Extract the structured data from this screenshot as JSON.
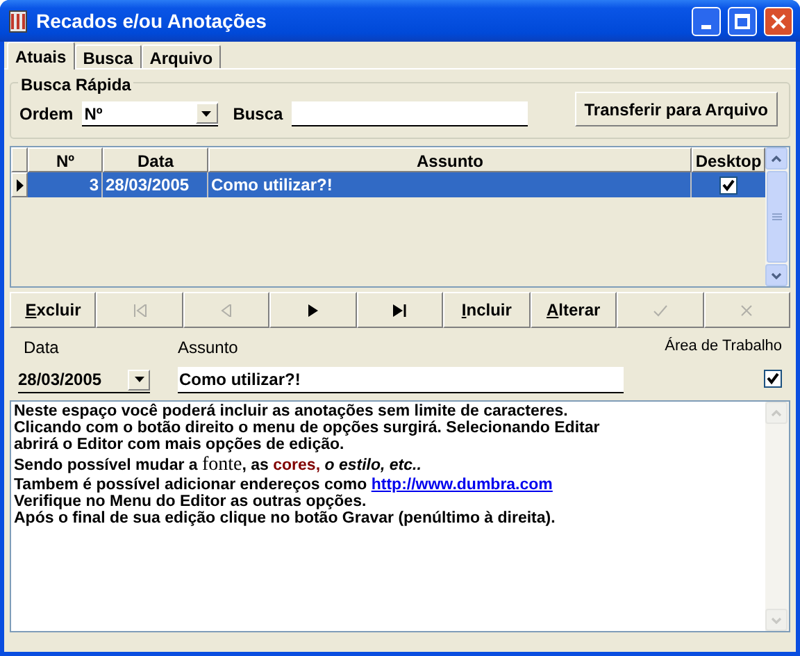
{
  "window": {
    "title": "Recados e/ou Anotações"
  },
  "tabs": [
    {
      "label": "Atuais",
      "selected": true
    },
    {
      "label": "Busca",
      "selected": false
    },
    {
      "label": "Arquivo",
      "selected": false
    }
  ],
  "quick_search": {
    "title": "Busca Rápida",
    "order_label": "Ordem",
    "order_value": "Nº",
    "search_label": "Busca",
    "transfer_button": "Transferir para Arquivo"
  },
  "table": {
    "columns": [
      "Nº",
      "Data",
      "Assunto",
      "Desktop"
    ],
    "rows": [
      {
        "number": "3",
        "date": "28/03/2005",
        "subject": "Como utilizar?!",
        "desktop": true,
        "selected": true
      }
    ]
  },
  "navigator": [
    {
      "kind": "text",
      "hotkey": "E",
      "rest": "xcluir",
      "disabled": false
    },
    {
      "kind": "first",
      "disabled": true
    },
    {
      "kind": "prev",
      "disabled": true
    },
    {
      "kind": "next",
      "disabled": false
    },
    {
      "kind": "last",
      "disabled": false
    },
    {
      "kind": "text",
      "hotkey": "I",
      "rest": "ncluir",
      "disabled": false
    },
    {
      "kind": "text",
      "hotkey": "A",
      "rest": "lterar",
      "disabled": false
    },
    {
      "kind": "post",
      "disabled": true
    },
    {
      "kind": "cancel",
      "disabled": true
    }
  ],
  "form": {
    "date_label": "Data",
    "date_value": "28/03/2005",
    "subject_label": "Assunto",
    "subject_value": "Como utilizar?!",
    "desktop_label": "Área de Trabalho",
    "desktop_checked": true
  },
  "memo": [
    [
      {
        "kind": "plain",
        "text": "Neste espaço você poderá incluir as anotações sem limite de caracteres."
      }
    ],
    [
      {
        "kind": "plain",
        "text": "Clicando com o botão direito o menu de opções surgirá. Selecionando Editar"
      }
    ],
    [
      {
        "kind": "plain",
        "text": "abrirá o Editor com mais opções de edição."
      }
    ],
    [
      {
        "kind": "plain",
        "text": "Sendo possível mudar a "
      },
      {
        "kind": "serif",
        "text": "fonte"
      },
      {
        "kind": "plain",
        "text": ", as "
      },
      {
        "kind": "colored",
        "text": "cores,",
        "color": "#800000"
      },
      {
        "kind": "italic",
        "text": " o estilo, etc.."
      }
    ],
    [
      {
        "kind": "plain",
        "text": "Tambem é possível adicionar endereços como "
      },
      {
        "kind": "link",
        "text": "http://www.dumbra.com"
      }
    ],
    [
      {
        "kind": "plain",
        "text": "Verifique no Menu do Editor as outras opções."
      }
    ],
    [
      {
        "kind": "plain",
        "text": "Após o final de sua edição clique no botão Gravar (penúltimo à direita)."
      }
    ]
  ]
}
